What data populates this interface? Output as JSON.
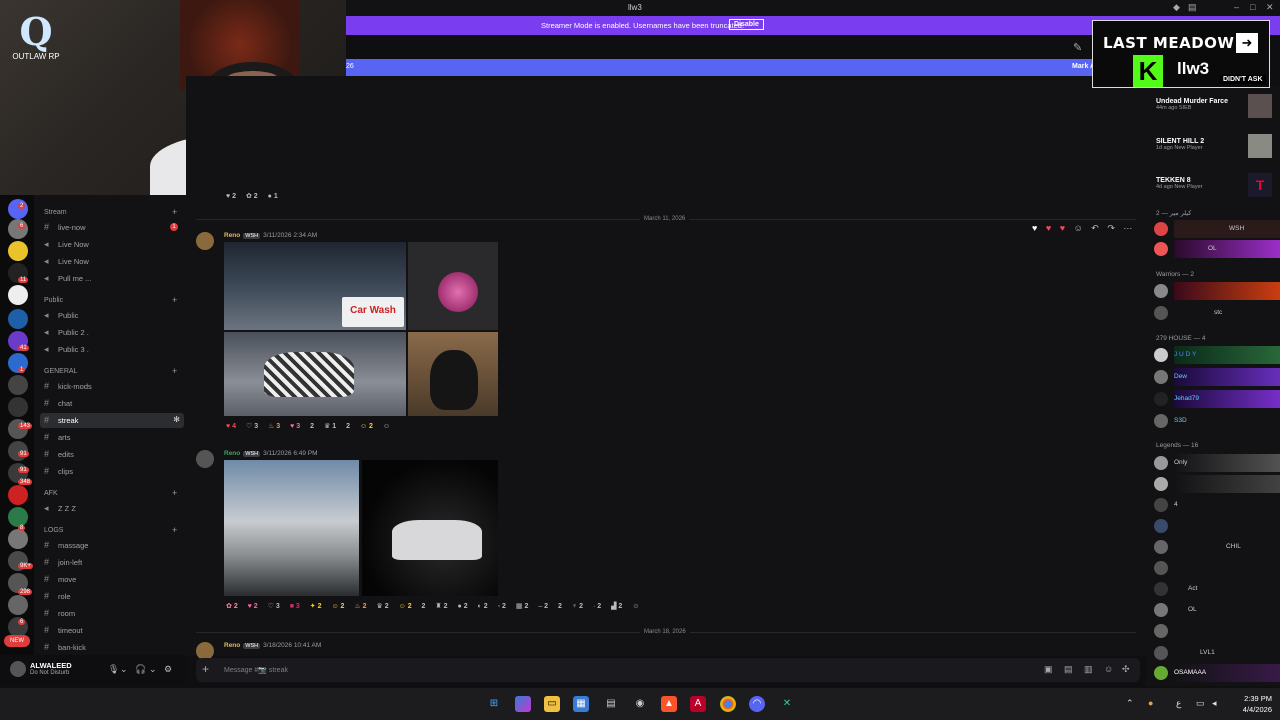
{
  "window": {
    "title": "llw3"
  },
  "streamer_banner": {
    "message": "Streamer Mode is enabled. Usernames have been truncated.",
    "button": "Disable"
  },
  "blue_banner": {
    "left_text": "26",
    "right_text": "Mark As Read"
  },
  "webcam_overlay": {
    "brand": "OUTLAW RP"
  },
  "stream_overlay": {
    "game": "LAST MEADOW",
    "kick_letter": "K",
    "handle": "llw3",
    "badge": "DIDN'T ASK"
  },
  "server_badges": [
    "2",
    "6",
    "11",
    "41",
    "1",
    "143",
    "91",
    "91",
    "348",
    "8",
    "9K+",
    "298",
    "6"
  ],
  "channels": {
    "stream_cat": "Stream",
    "stream": [
      {
        "name": "live-now",
        "badge": "1"
      },
      {
        "name": "Live Now"
      },
      {
        "name": "Live Now"
      },
      {
        "name": "Pull me ..."
      }
    ],
    "public_cat": "Public",
    "public": [
      {
        "name": "Public"
      },
      {
        "name": "Public 2 ."
      },
      {
        "name": "Public 3 ."
      }
    ],
    "general_cat": "GENERAL",
    "general": [
      {
        "name": "kick-mods"
      },
      {
        "name": "chat"
      },
      {
        "name": "streak"
      },
      {
        "name": "arts"
      },
      {
        "name": "edits"
      },
      {
        "name": "clips"
      }
    ],
    "afk_cat": "AFK",
    "afk": [
      {
        "name": "Z Z Z"
      }
    ],
    "logs_cat": "LOGS",
    "logs": [
      {
        "name": "massage"
      },
      {
        "name": "join-left"
      },
      {
        "name": "move"
      },
      {
        "name": "role"
      },
      {
        "name": "room"
      },
      {
        "name": "timeout"
      },
      {
        "name": "ban-kick"
      }
    ]
  },
  "user": {
    "name": "ALWALEED",
    "status": "Do Not Disturb"
  },
  "chat": {
    "top_reacts": [
      "2",
      "2",
      "1"
    ],
    "date1": "March 11, 2026",
    "msg1": {
      "user": "Reno",
      "tag": "WSH",
      "time": "3/11/2026 2:34 AM",
      "sign_text": "Car Wash"
    },
    "msg1_reacts": [
      "4",
      "3",
      "3",
      "3",
      "2",
      "1",
      "2",
      "2"
    ],
    "msg2": {
      "user": "Reno",
      "tag": "WSH",
      "time": "3/11/2026 6:49 PM"
    },
    "msg2_reacts": [
      "2",
      "2",
      "3",
      "3",
      "2",
      "2",
      "2",
      "2",
      "2",
      "2",
      "2",
      "2",
      "2",
      "2",
      "2",
      "2",
      "2",
      "2",
      "2",
      "2",
      "2"
    ],
    "date2": "March 18, 2026",
    "msg3": {
      "user": "Reno",
      "tag": "WSH",
      "time": "3/18/2026 10:41 AM"
    },
    "composer_placeholder": "Message #📷 streak"
  },
  "activities": [
    {
      "name": "Undead Murder Farce",
      "sub": "44m ago  SIEB"
    },
    {
      "name": "SILENT HILL 2",
      "sub": "1d ago  New Player"
    },
    {
      "name": "TEKKEN 8",
      "sub": "4d ago  New Player"
    }
  ],
  "member_groups": [
    {
      "cat": "كيلر مير — 2",
      "members": [
        "WSH",
        "OL"
      ]
    },
    {
      "cat": "Warriors — 2",
      "members": [
        "",
        "stc"
      ]
    },
    {
      "cat": "279 HOUSE — 4",
      "members": [
        "J U D Y",
        "Dew",
        "Jehad79",
        "S3D"
      ]
    },
    {
      "cat": "Legends — 16",
      "members": [
        "Only",
        "",
        "4",
        "",
        "CHIL",
        "",
        "Act",
        "OL",
        "",
        "LVL1",
        "OSAMAAA"
      ]
    }
  ],
  "taskbar": {
    "time": "2:39 PM",
    "date": "4/4/2026",
    "lang": "ع"
  }
}
